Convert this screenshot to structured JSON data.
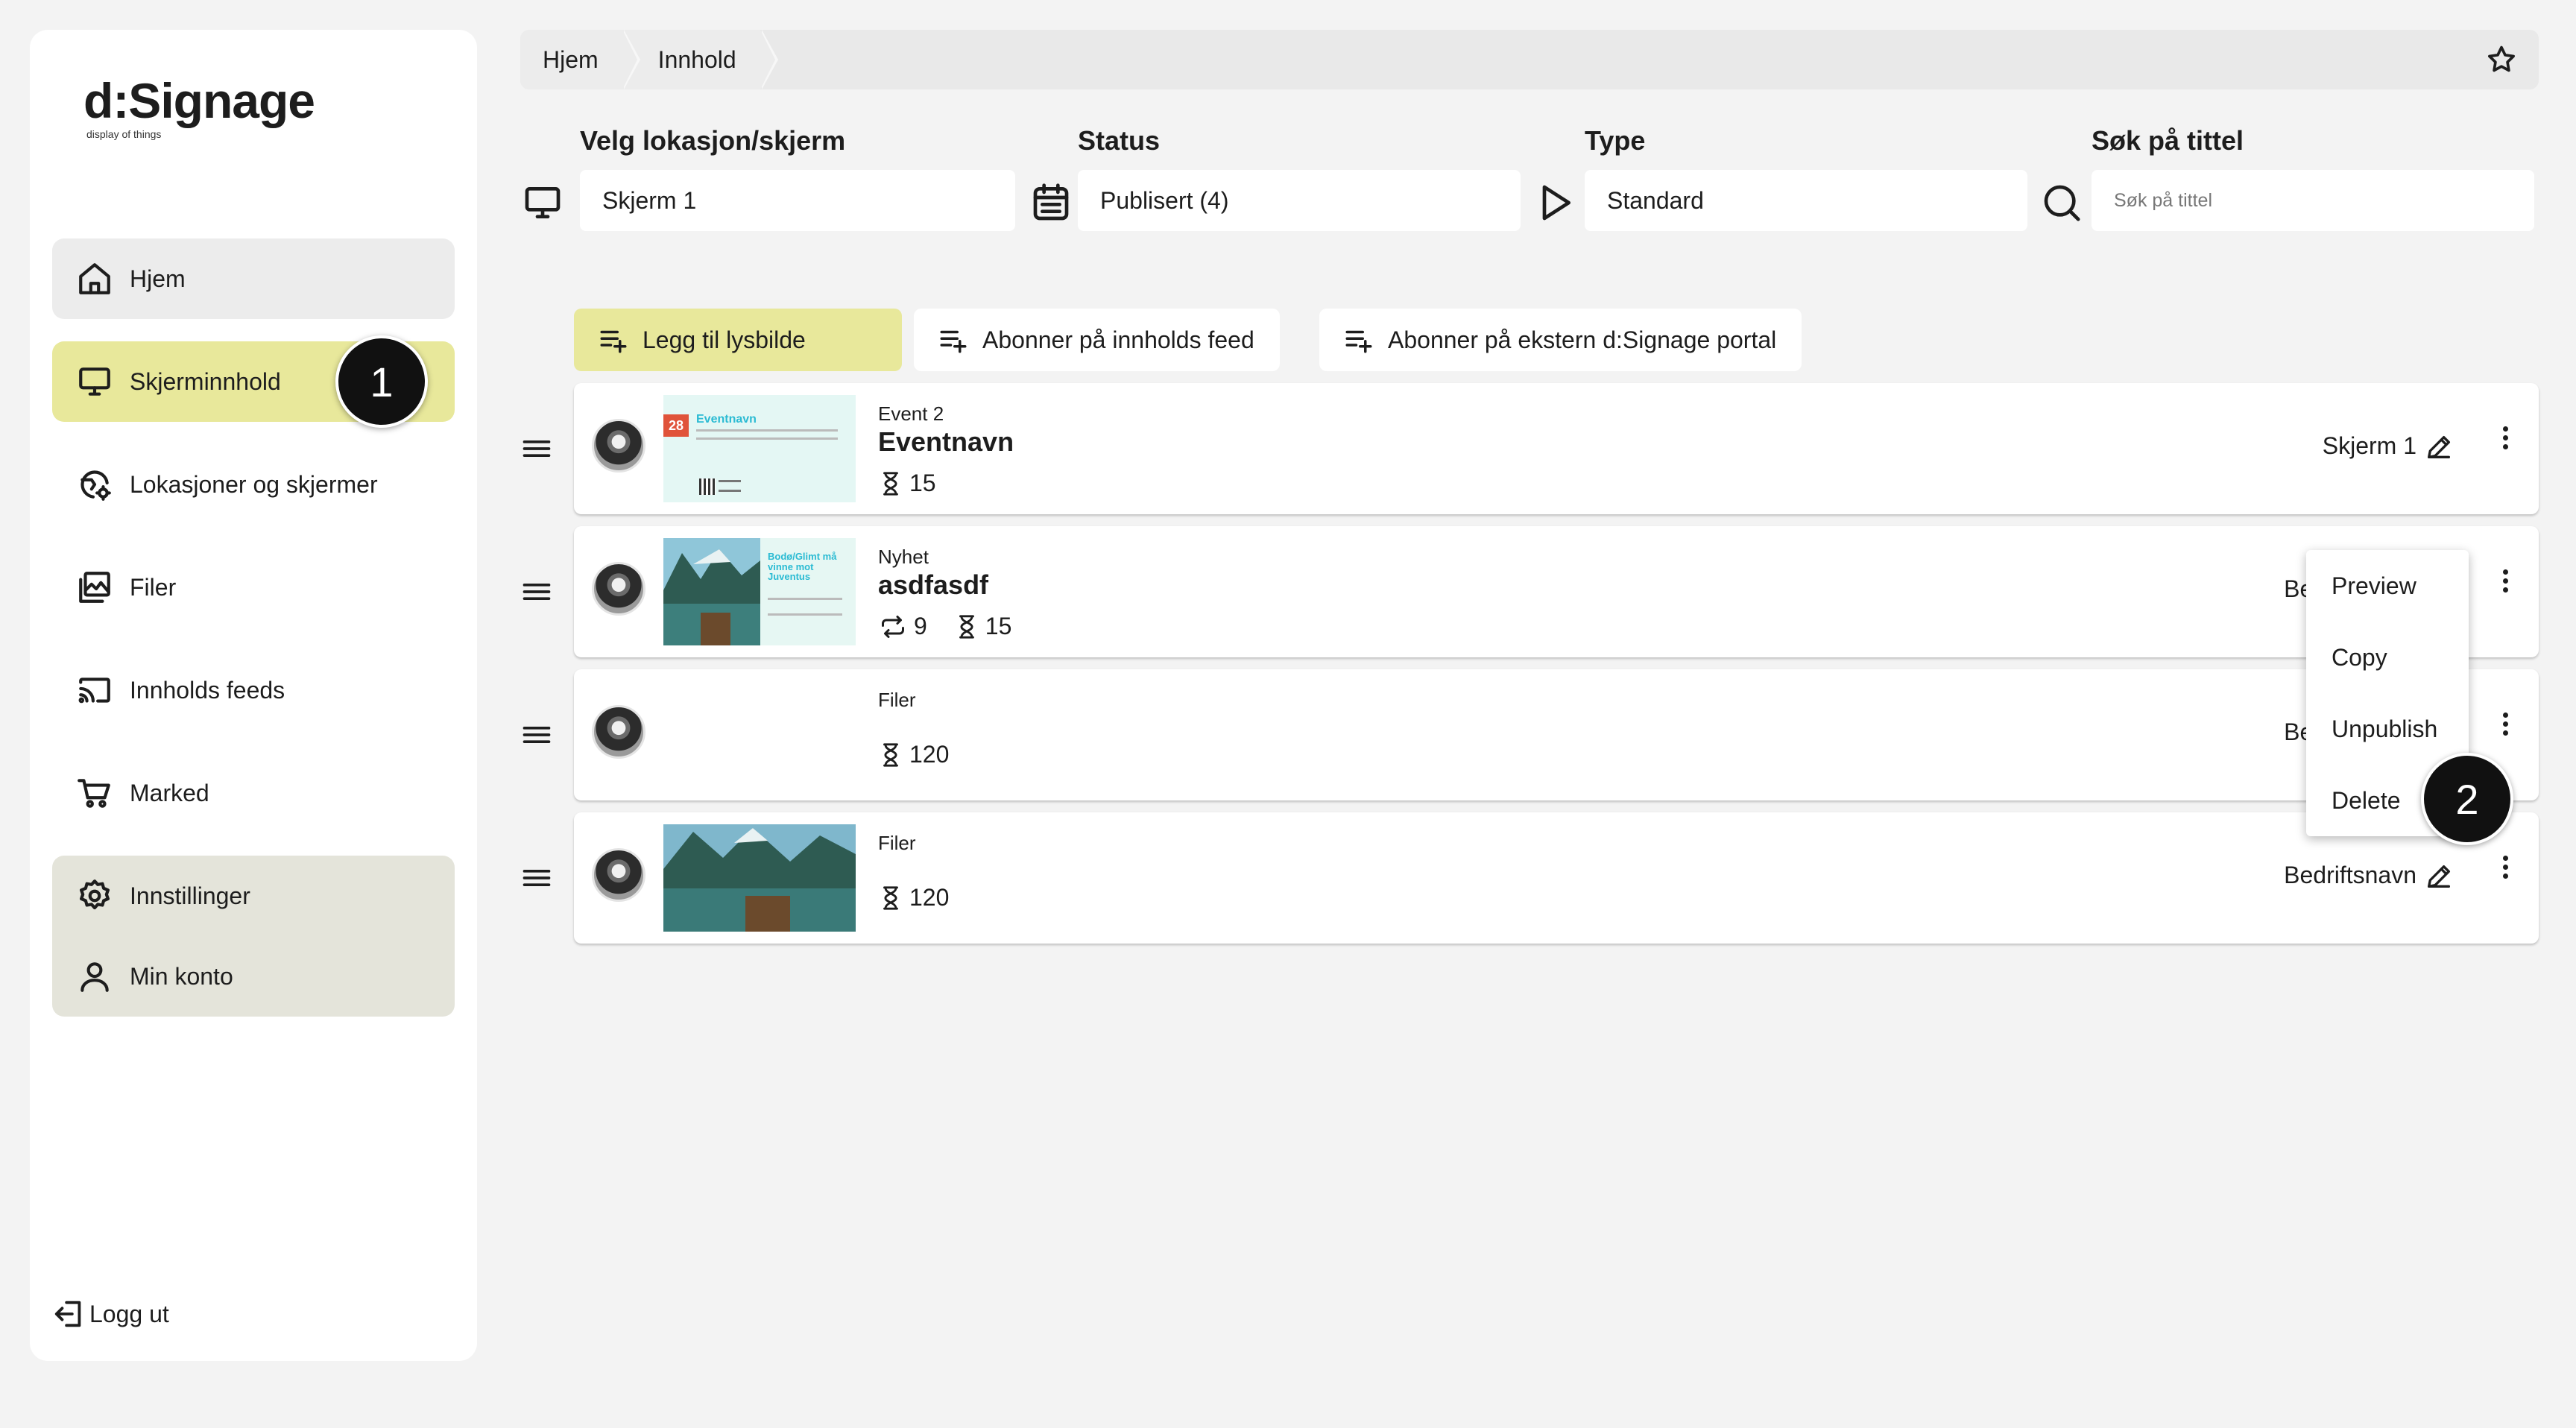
{
  "brand": {
    "name": "d:Signage",
    "tagline": "display of things"
  },
  "sidebar": {
    "items": [
      {
        "label": "Hjem"
      },
      {
        "label": "Skjerminnhold"
      },
      {
        "label": "Lokasjoner og skjermer"
      },
      {
        "label": "Filer"
      },
      {
        "label": "Innholds feeds"
      },
      {
        "label": "Marked"
      },
      {
        "label": "Innstillinger"
      },
      {
        "label": "Min konto"
      }
    ],
    "logout": "Logg ut"
  },
  "breadcrumb": [
    "Hjem",
    "Innhold"
  ],
  "filters": {
    "location": {
      "label": "Velg lokasjon/skjerm",
      "value": "Skjerm 1"
    },
    "status": {
      "label": "Status",
      "value": "Publisert (4)"
    },
    "type": {
      "label": "Type",
      "value": "Standard"
    },
    "search": {
      "label": "Søk på tittel",
      "placeholder": "Søk på tittel"
    }
  },
  "actions": {
    "add_slide": "Legg til lysbilde",
    "subscribe_feed": "Abonner på innholds feed",
    "subscribe_portal": "Abonner på ekstern d:Signage portal"
  },
  "rows": [
    {
      "category": "Event 2",
      "title": "Eventnavn",
      "duration": "15",
      "location": "Skjerm 1",
      "thumb": {
        "date": "28",
        "title": "Eventnavn"
      }
    },
    {
      "category": "Nyhet",
      "title": "asdfasdf",
      "repeat": "9",
      "duration": "15",
      "location": "Bedriftsnavn",
      "thumb": {
        "title": "Bodø/Glimt må vinne mot Juventus"
      }
    },
    {
      "category": "Filer",
      "duration": "120",
      "location": "Bedriftsnavn"
    },
    {
      "category": "Filer",
      "duration": "120",
      "location": "Bedriftsnavn"
    }
  ],
  "menu": {
    "items": [
      "Preview",
      "Copy",
      "Unpublish",
      "Delete"
    ]
  },
  "badges": [
    "1",
    "2"
  ],
  "colors": {
    "accent": "#e8e89b",
    "sidebar_group": "#e4e4da",
    "background": "#f3f3f3"
  }
}
